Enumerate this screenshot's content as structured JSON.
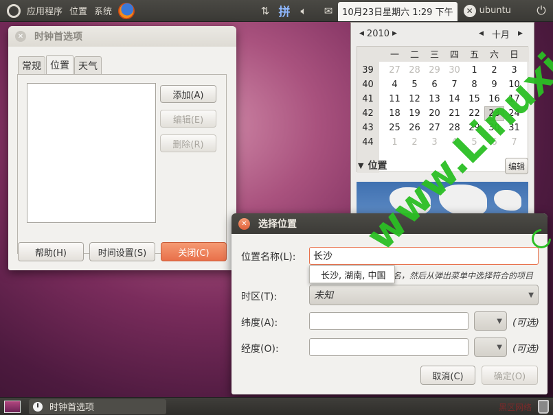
{
  "top_panel": {
    "menus": [
      "应用程序",
      "位置",
      "系统"
    ],
    "input_method": "拼",
    "clock": "10月23日星期六  1:29 下午",
    "user": "ubuntu"
  },
  "prefs_window": {
    "title": "时钟首选项",
    "tabs": [
      "常规",
      "位置",
      "天气"
    ],
    "buttons": {
      "add": "添加(A)",
      "edit": "编辑(E)",
      "delete": "删除(R)"
    },
    "footer": {
      "help": "帮助(H)",
      "time_settings": "时间设置(S)",
      "close": "关闭(C)"
    }
  },
  "calendar": {
    "year": "2010",
    "month": "十月",
    "weekdays": [
      "一",
      "二",
      "三",
      "四",
      "五",
      "六",
      "日"
    ],
    "weeks": [
      {
        "num": "39",
        "days": [
          "27",
          "28",
          "29",
          "30",
          "1",
          "2",
          "3"
        ]
      },
      {
        "num": "40",
        "days": [
          "4",
          "5",
          "6",
          "7",
          "8",
          "9",
          "10"
        ]
      },
      {
        "num": "41",
        "days": [
          "11",
          "12",
          "13",
          "14",
          "15",
          "16",
          "17"
        ]
      },
      {
        "num": "42",
        "days": [
          "18",
          "19",
          "20",
          "21",
          "22",
          "23",
          "24"
        ]
      },
      {
        "num": "43",
        "days": [
          "25",
          "26",
          "27",
          "28",
          "29",
          "30",
          "31"
        ]
      },
      {
        "num": "44",
        "days": [
          "1",
          "2",
          "3",
          "4",
          "5",
          "6",
          "7"
        ]
      }
    ],
    "today": "23",
    "section_title": "位置",
    "edit_button": "编辑"
  },
  "select_dialog": {
    "title": "选择位置",
    "location_label": "位置名称(L):",
    "location_value": "长沙",
    "suggestion": "长沙, 湖南, 中国",
    "hint": "名，然后从弹出菜单中选择符合的项目",
    "timezone_label": "时区(T):",
    "timezone_value": "未知",
    "latitude_label": "纬度(A):",
    "longitude_label": "经度(O):",
    "optional": "(可选)",
    "cancel": "取消(C)",
    "ok": "确定(O)"
  },
  "taskbar": {
    "task": "时钟首选项"
  },
  "watermark": {
    "text": "www.Linuxidc.com",
    "site": "黑区网络"
  }
}
